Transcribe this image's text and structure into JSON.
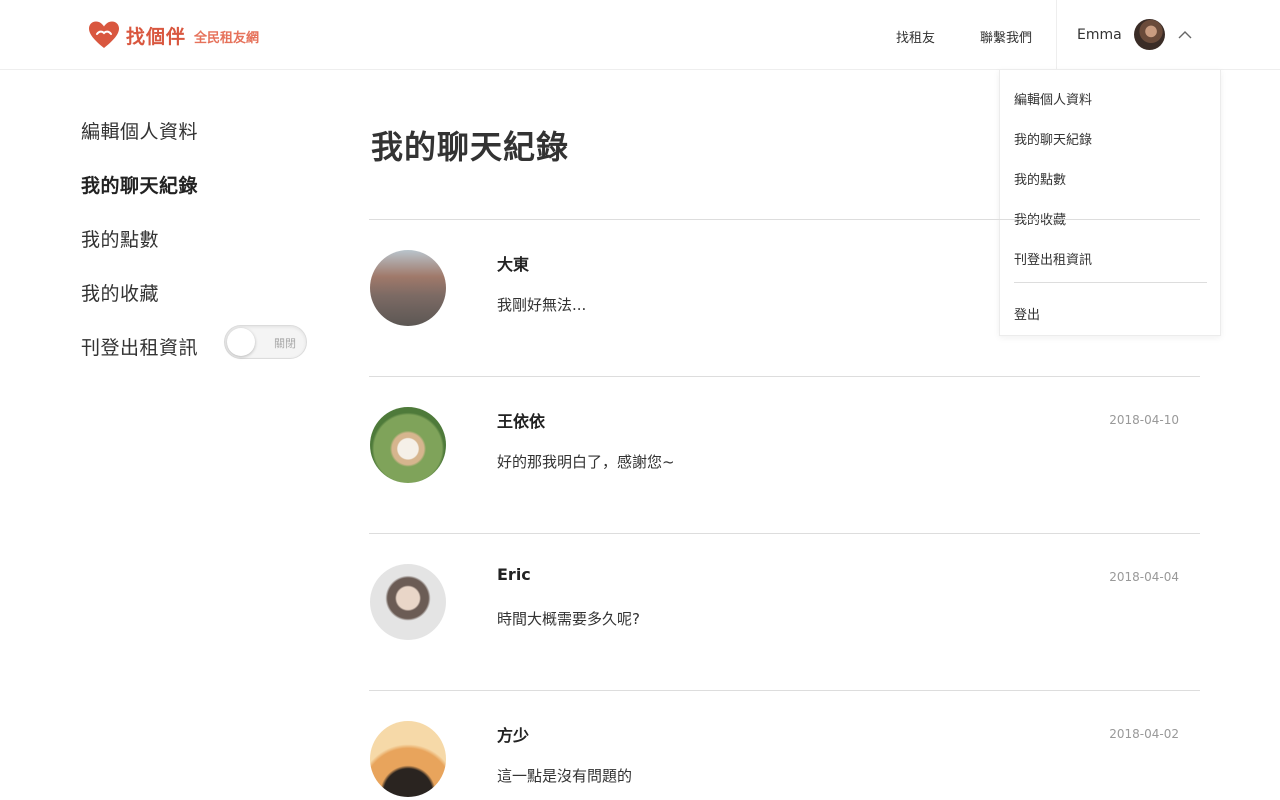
{
  "header": {
    "logo_name": "找個伴",
    "logo_tagline": "全民租友網",
    "nav": [
      {
        "label": "找租友"
      },
      {
        "label": "聯繫我們"
      }
    ],
    "user_name": "Emma",
    "chevron_icon": "chevron-up-icon"
  },
  "dropdown": {
    "items": [
      {
        "label": "編輯個人資料"
      },
      {
        "label": "我的聊天紀錄"
      },
      {
        "label": "我的點數"
      },
      {
        "label": "我的收藏"
      },
      {
        "label": "刊登出租資訊"
      }
    ],
    "logout": "登出"
  },
  "sidebar": {
    "items": [
      {
        "label": "編輯個人資料",
        "active": false
      },
      {
        "label": "我的聊天紀錄",
        "active": true
      },
      {
        "label": "我的點數",
        "active": false
      },
      {
        "label": "我的收藏",
        "active": false
      },
      {
        "label": "刊登出租資訊",
        "active": false
      }
    ],
    "toggle": {
      "label": "關閉",
      "on": false
    }
  },
  "main": {
    "title": "我的聊天紀錄",
    "chats": [
      {
        "name": "大東",
        "message": "我剛好無法...",
        "date": ""
      },
      {
        "name": "王依依",
        "message": "好的那我明白了，感謝您~",
        "date": "2018-04-10"
      },
      {
        "name": "Eric",
        "message": "時間大概需要多久呢?",
        "date": "2018-04-04"
      },
      {
        "name": "方少",
        "message": "這一點是沒有問題的",
        "date": "2018-04-02"
      }
    ]
  },
  "colors": {
    "brand": "#d9573f",
    "brand_light": "#e6725b",
    "divider": "#dddddd",
    "date_text": "#999999"
  }
}
